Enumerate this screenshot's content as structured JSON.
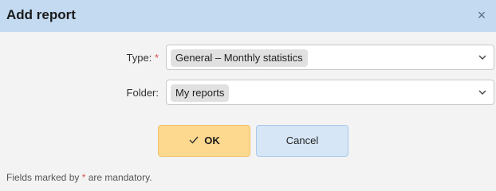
{
  "dialog": {
    "title": "Add report",
    "close_symbol": "×"
  },
  "form": {
    "type": {
      "label": "Type:",
      "required_marker": "*",
      "selected_value": "General – Monthly statistics"
    },
    "folder": {
      "label": "Folder:",
      "selected_value": "My reports"
    }
  },
  "buttons": {
    "ok_label": "OK",
    "cancel_label": "Cancel"
  },
  "footer": {
    "text_before": "Fields marked by ",
    "required_marker": "*",
    "text_after": " are mandatory."
  },
  "colors": {
    "titlebar": "#c3daf1",
    "ok_button": "#fcd98f",
    "cancel_button": "#d6e6f7",
    "required_marker": "#d9534f"
  },
  "icons": {
    "close": "close-icon",
    "dropdown": "chevron-down-icon",
    "confirm": "check-icon"
  }
}
